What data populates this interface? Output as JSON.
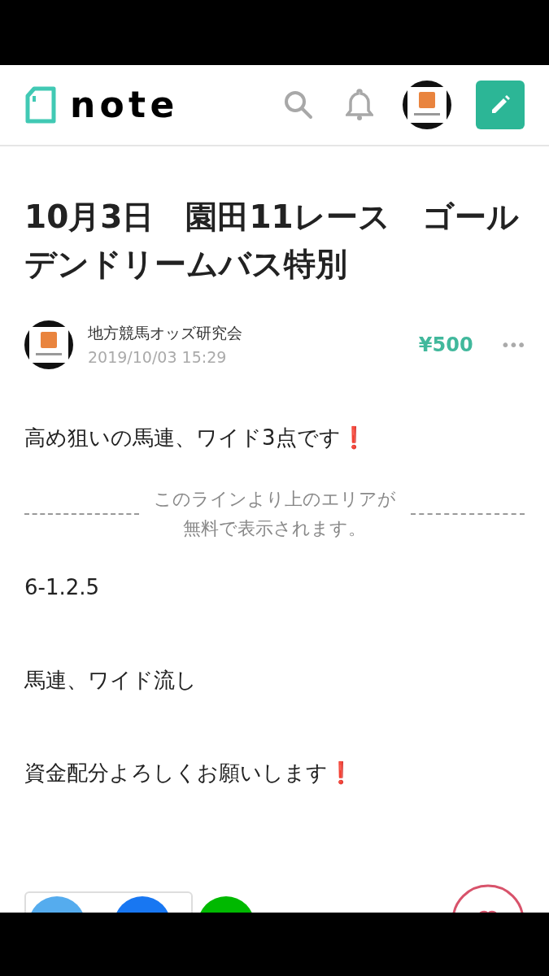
{
  "header": {
    "logo": "note"
  },
  "article": {
    "title": "10月3日　園田11レース　ゴールデンドリームバス特別",
    "author": {
      "name": "地方競馬オッズ研究会",
      "date": "2019/10/03 15:29"
    },
    "price": "¥500",
    "more": "•••",
    "intro": "高め狙いの馬連、ワイド3点です❗",
    "paywall": {
      "line1": "このラインより上のエリアが",
      "line2": "無料で表示されます。"
    },
    "paragraphs": [
      "6-1.2.5",
      "馬連、ワイド流し",
      "資金配分よろしくお願いします❗"
    ]
  }
}
